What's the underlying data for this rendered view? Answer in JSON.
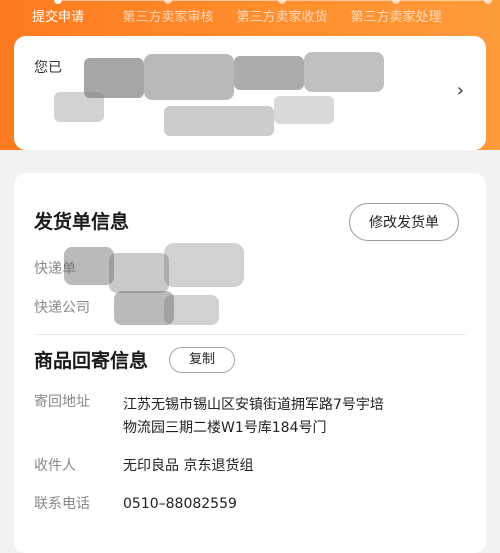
{
  "progress": {
    "steps": [
      {
        "label": "提交申请",
        "active": true
      },
      {
        "label": "第三方卖家审核",
        "active": false
      },
      {
        "label": "第三方卖家收货",
        "active": false
      },
      {
        "label": "第三方卖家处理",
        "active": false
      },
      {
        "label": "",
        "active": false
      }
    ]
  },
  "notice": {
    "text_visible": "您已",
    "arrow": "›"
  },
  "shipment": {
    "title": "发货单信息",
    "modify_button": "修改发货单",
    "tracking_label": "快递单",
    "company_label": "快递公司"
  },
  "return_info": {
    "title": "商品回寄信息",
    "copy_button": "复制",
    "address_label": "寄回地址",
    "address_line1": "江苏无锡市锡山区安镇街道拥军路7号宇培",
    "address_line2": "物流园三期二楼W1号库184号门",
    "recipient_label": "收件人",
    "recipient_value": "无印良品 京东退货组",
    "phone_label": "联系电话",
    "phone_value": "0510–88082559"
  },
  "colors": {
    "header_orange": "#ff8a2a",
    "card_bg": "#ffffff",
    "page_bg": "#f2f2f2"
  }
}
